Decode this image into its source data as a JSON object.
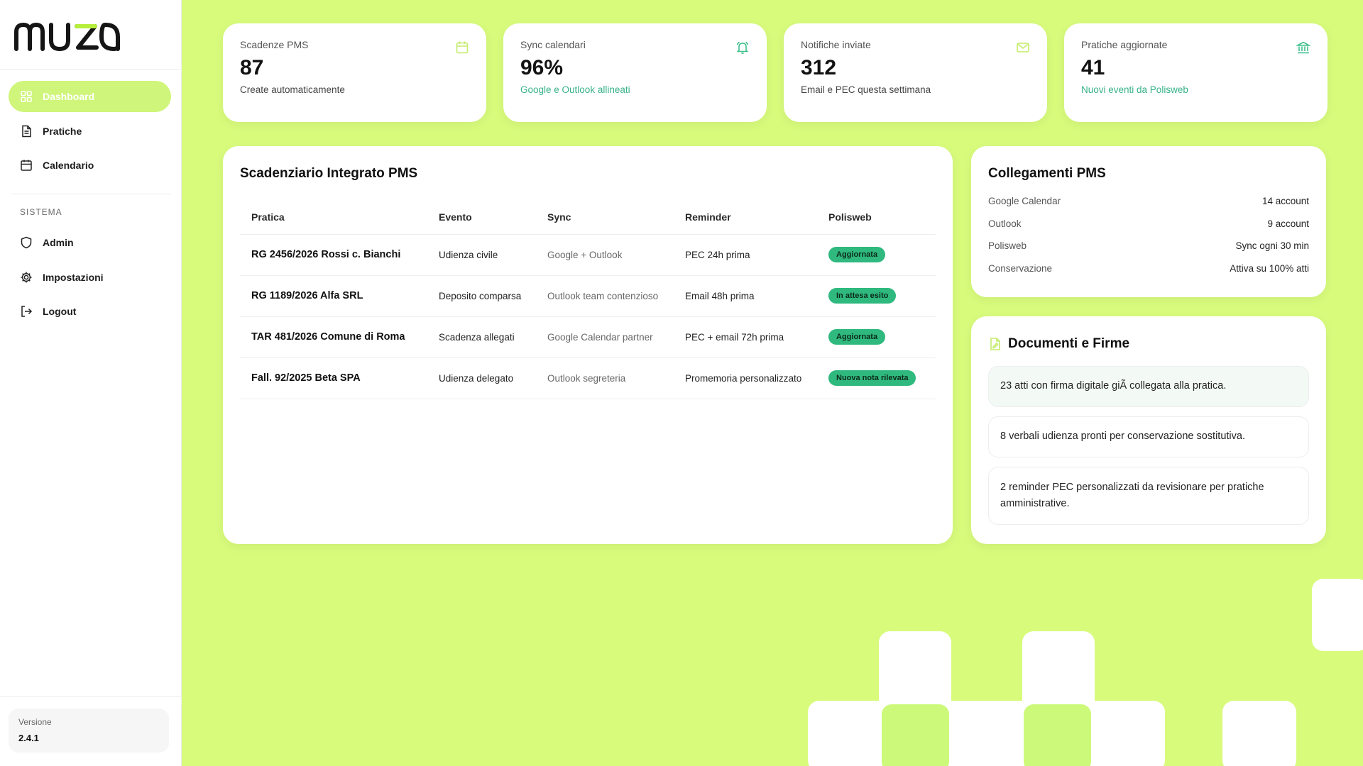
{
  "brand": {
    "logo_text": "muza",
    "accent": "#cff57a",
    "background": "#d8fb7c",
    "badge_color": "#2fb97e"
  },
  "sidebar": {
    "items": [
      {
        "label": "Dashboard",
        "icon": "grid-icon",
        "active": true
      },
      {
        "label": "Pratiche",
        "icon": "document-icon"
      },
      {
        "label": "Calendario",
        "icon": "calendar-icon"
      }
    ],
    "section_label": "SISTEMA",
    "system_items": [
      {
        "label": "Admin",
        "icon": "shield-icon"
      },
      {
        "label": "Impostazioni",
        "icon": "gear-icon"
      },
      {
        "label": "Logout",
        "icon": "logout-icon"
      }
    ],
    "version_label": "Versione",
    "version_value": "2.4.1"
  },
  "stats": [
    {
      "label": "Scadenze PMS",
      "value": "87",
      "sub": "Create automaticamente",
      "icon": "calendar-icon"
    },
    {
      "label": "Sync calendari",
      "value": "96%",
      "sub": "Google e Outlook allineati",
      "icon": "bell-icon"
    },
    {
      "label": "Notifiche inviate",
      "value": "312",
      "sub": "Email e PEC questa settimana",
      "icon": "mail-icon"
    },
    {
      "label": "Pratiche aggiornate",
      "value": "41",
      "sub": "Nuovi eventi da Polisweb",
      "icon": "bank-icon"
    }
  ],
  "schedule": {
    "title": "Scadenziario Integrato PMS",
    "columns": [
      "Pratica",
      "Evento",
      "Sync",
      "Reminder",
      "Polisweb"
    ],
    "rows": [
      {
        "pratica": "RG 2456/2026 Rossi c. Bianchi",
        "evento": "Udienza civile",
        "sync": "Google + Outlook",
        "reminder": "PEC 24h prima",
        "polisweb": "Aggiornata"
      },
      {
        "pratica": "RG 1189/2026 Alfa SRL",
        "evento": "Deposito comparsa",
        "sync": "Outlook team contenzioso",
        "reminder": "Email 48h prima",
        "polisweb": "In attesa esito"
      },
      {
        "pratica": "TAR 481/2026 Comune di Roma",
        "evento": "Scadenza allegati",
        "sync": "Google Calendar partner",
        "reminder": "PEC + email 72h prima",
        "polisweb": "Aggiornata"
      },
      {
        "pratica": "Fall. 92/2025 Beta SPA",
        "evento": "Udienza delegato",
        "sync": "Outlook segreteria",
        "reminder": "Promemoria personalizzato",
        "polisweb": "Nuova nota rilevata"
      }
    ]
  },
  "links": {
    "title": "Collegamenti PMS",
    "items": [
      {
        "key": "Google Calendar",
        "value": "14 account"
      },
      {
        "key": "Outlook",
        "value": "9 account"
      },
      {
        "key": "Polisweb",
        "value": "Sync ogni 30 min"
      },
      {
        "key": "Conservazione",
        "value": "Attiva su 100% atti"
      }
    ]
  },
  "docs": {
    "title": "Documenti e Firme",
    "icon": "document-pen-icon",
    "items": [
      "23 atti con firma digitale giÃ  collegata alla pratica.",
      "8 verbali udienza pronti per conservazione sostitutiva.",
      "2 reminder PEC personalizzati da revisionare per pratiche amministrative."
    ]
  }
}
